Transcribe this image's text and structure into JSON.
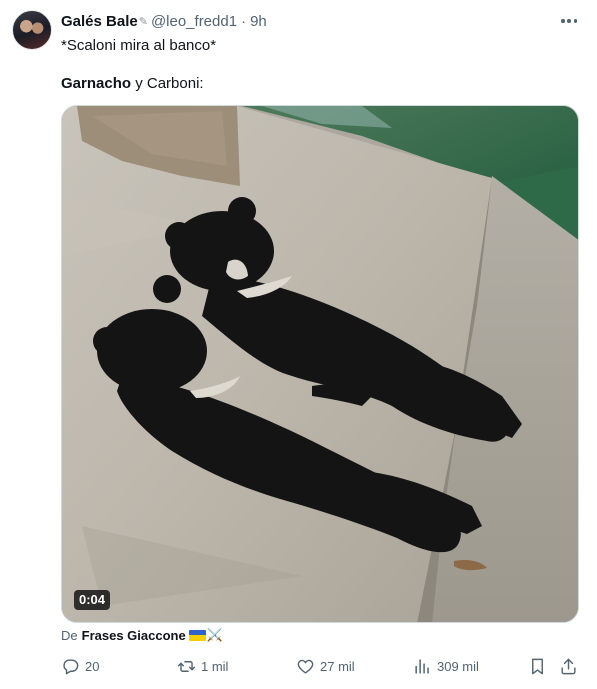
{
  "author": {
    "display_name": "Galés Bale",
    "handle": "@leo_fredd1",
    "separator": "·",
    "time": "9h"
  },
  "tweet": {
    "text_line1": "*Scaloni mira al banco*",
    "line2_bold": "Garnacho",
    "line2_rest": " y Carboni:"
  },
  "media": {
    "duration": "0:04"
  },
  "source": {
    "prefix": "De",
    "name": "Frases Giaccone",
    "emoji": "⚔️"
  },
  "actions": {
    "replies": "20",
    "retweets": "1 mil",
    "likes": "27 mil",
    "views": "309 mil"
  },
  "icons": [
    "more-icon",
    "reply-icon",
    "retweet-icon",
    "like-icon",
    "views-icon",
    "bookmark-icon",
    "share-icon",
    "pen-icon",
    "flag-icon",
    "swords-icon"
  ],
  "colors": {
    "text": "#0f1419",
    "secondary": "#536471",
    "border": "#cfd9de"
  }
}
